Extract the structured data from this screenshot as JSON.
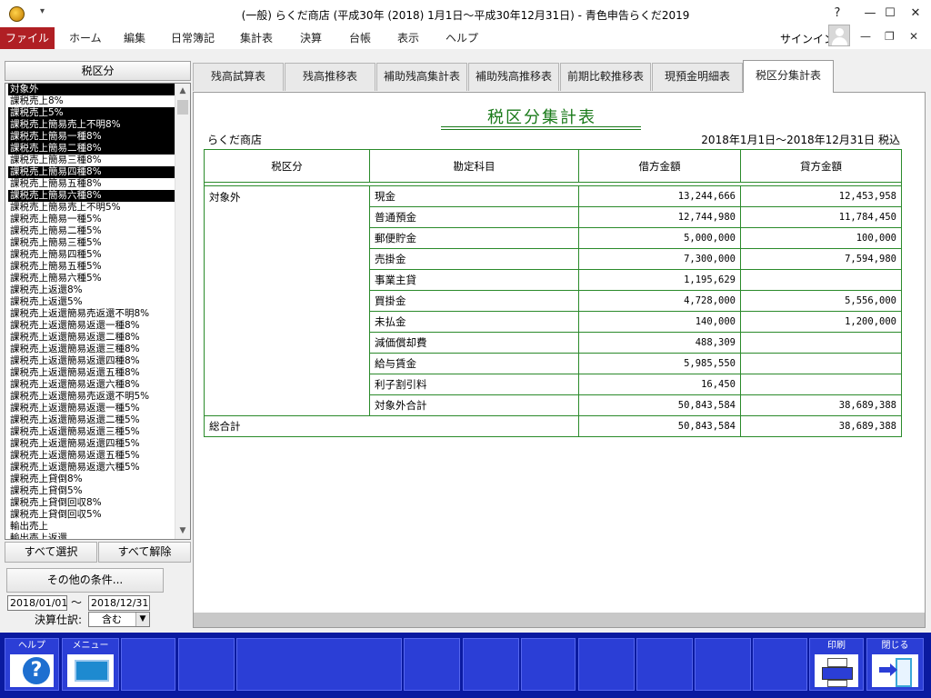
{
  "window": {
    "title": "(一般) らくだ商店 (平成30年 (2018) 1月1日〜平成30年12月31日) - 青色申告らくだ2019",
    "help_glyph": "?",
    "min_glyph": "—",
    "max_glyph": "☐",
    "close_glyph": "✕"
  },
  "menubar": {
    "items": [
      "ファイル",
      "ホーム",
      "編集",
      "日常簿記",
      "集計表",
      "決算",
      "台帳",
      "表示",
      "ヘルプ"
    ],
    "signin": "サインイン",
    "min_glyph": "—",
    "restore_glyph": "❐",
    "close_glyph": "✕"
  },
  "left": {
    "header": "税区分",
    "items": [
      {
        "label": "対象外",
        "selected": true
      },
      {
        "label": "課税売上8%",
        "selected": false
      },
      {
        "label": "課税売上5%",
        "selected": true
      },
      {
        "label": "課税売上簡易売上不明8%",
        "selected": true
      },
      {
        "label": "課税売上簡易一種8%",
        "selected": true
      },
      {
        "label": "課税売上簡易二種8%",
        "selected": true
      },
      {
        "label": "課税売上簡易三種8%",
        "selected": false
      },
      {
        "label": "課税売上簡易四種8%",
        "selected": true
      },
      {
        "label": "課税売上簡易五種8%",
        "selected": false
      },
      {
        "label": "課税売上簡易六種8%",
        "selected": true
      },
      {
        "label": "課税売上簡易売上不明5%",
        "selected": false
      },
      {
        "label": "課税売上簡易一種5%",
        "selected": false
      },
      {
        "label": "課税売上簡易二種5%",
        "selected": false
      },
      {
        "label": "課税売上簡易三種5%",
        "selected": false
      },
      {
        "label": "課税売上簡易四種5%",
        "selected": false
      },
      {
        "label": "課税売上簡易五種5%",
        "selected": false
      },
      {
        "label": "課税売上簡易六種5%",
        "selected": false
      },
      {
        "label": "課税売上返還8%",
        "selected": false
      },
      {
        "label": "課税売上返還5%",
        "selected": false
      },
      {
        "label": "課税売上返還簡易売返還不明8%",
        "selected": false
      },
      {
        "label": "課税売上返還簡易返還一種8%",
        "selected": false
      },
      {
        "label": "課税売上返還簡易返還二種8%",
        "selected": false
      },
      {
        "label": "課税売上返還簡易返還三種8%",
        "selected": false
      },
      {
        "label": "課税売上返還簡易返還四種8%",
        "selected": false
      },
      {
        "label": "課税売上返還簡易返還五種8%",
        "selected": false
      },
      {
        "label": "課税売上返還簡易返還六種8%",
        "selected": false
      },
      {
        "label": "課税売上返還簡易売返還不明5%",
        "selected": false
      },
      {
        "label": "課税売上返還簡易返還一種5%",
        "selected": false
      },
      {
        "label": "課税売上返還簡易返還二種5%",
        "selected": false
      },
      {
        "label": "課税売上返還簡易返還三種5%",
        "selected": false
      },
      {
        "label": "課税売上返還簡易返還四種5%",
        "selected": false
      },
      {
        "label": "課税売上返還簡易返還五種5%",
        "selected": false
      },
      {
        "label": "課税売上返還簡易返還六種5%",
        "selected": false
      },
      {
        "label": "課税売上貸倒8%",
        "selected": false
      },
      {
        "label": "課税売上貸倒5%",
        "selected": false
      },
      {
        "label": "課税売上貸倒回収8%",
        "selected": false
      },
      {
        "label": "課税売上貸倒回収5%",
        "selected": false
      },
      {
        "label": "輸出売上",
        "selected": false
      },
      {
        "label": "輸出売上返還",
        "selected": false
      }
    ],
    "select_all": "すべて選択",
    "deselect_all": "すべて解除",
    "other_conditions": "その他の条件...",
    "date_from": "2018/01/01",
    "date_sep": "〜",
    "date_to": "2018/12/31",
    "kessan_label": "決算仕訳:",
    "kessan_value": "含む",
    "scroll_up_glyph": "▲",
    "scroll_down_glyph": "▼",
    "dropdown_glyph": "▼"
  },
  "tabs": [
    {
      "label": "残高試算表",
      "active": false
    },
    {
      "label": "残高推移表",
      "active": false
    },
    {
      "label": "補助残高集計表",
      "active": false
    },
    {
      "label": "補助残高推移表",
      "active": false
    },
    {
      "label": "前期比較推移表",
      "active": false
    },
    {
      "label": "現預金明細表",
      "active": false
    },
    {
      "label": "税区分集計表",
      "active": true
    }
  ],
  "report": {
    "title": "税区分集計表",
    "shop": "らくだ商店",
    "period": "2018年1月1日〜2018年12月31日 税込",
    "headers": [
      "税区分",
      "勘定科目",
      "借方金額",
      "貸方金額"
    ],
    "category": "対象外",
    "rows": [
      {
        "account": "現金",
        "debit": "13,244,666",
        "credit": "12,453,958"
      },
      {
        "account": "普通預金",
        "debit": "12,744,980",
        "credit": "11,784,450"
      },
      {
        "account": "郵便貯金",
        "debit": "5,000,000",
        "credit": "100,000"
      },
      {
        "account": "売掛金",
        "debit": "7,300,000",
        "credit": "7,594,980"
      },
      {
        "account": "事業主貸",
        "debit": "1,195,629",
        "credit": ""
      },
      {
        "account": "買掛金",
        "debit": "4,728,000",
        "credit": "5,556,000"
      },
      {
        "account": "未払金",
        "debit": "140,000",
        "credit": "1,200,000"
      },
      {
        "account": "減価償却費",
        "debit": "488,309",
        "credit": ""
      },
      {
        "account": "給与賃金",
        "debit": "5,985,550",
        "credit": ""
      },
      {
        "account": "利子割引料",
        "debit": "16,450",
        "credit": ""
      }
    ],
    "subtotal": {
      "label": "対象外合計",
      "debit": "50,843,584",
      "credit": "38,689,388"
    },
    "total": {
      "label": "総合計",
      "debit": "50,843,584",
      "credit": "38,689,388"
    }
  },
  "fbar": {
    "help": "ヘルプ",
    "help_glyph": "?",
    "menu": "メニュー",
    "print": "印刷",
    "close": "閉じる"
  },
  "colors": {
    "accent_green": "#1a7a1a",
    "file_menu": "#b01f24",
    "fbar_bg": "#0a1aa0",
    "fkey_bg": "#2b3ed6"
  }
}
